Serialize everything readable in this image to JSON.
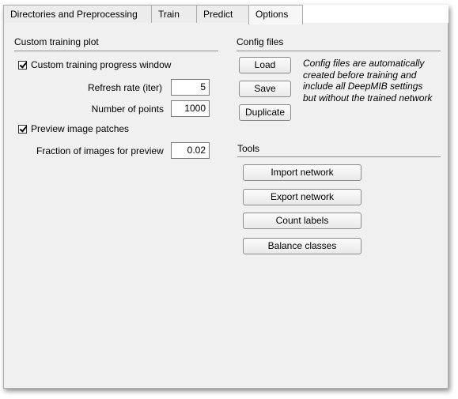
{
  "tabs": [
    {
      "label": "Directories and Preprocessing",
      "active": false
    },
    {
      "label": "Train",
      "active": false
    },
    {
      "label": "Predict",
      "active": false
    },
    {
      "label": "Options",
      "active": true
    }
  ],
  "custom_plot": {
    "title": "Custom training plot",
    "progress_window": {
      "label": "Custom training progress window",
      "checked": true
    },
    "refresh_rate": {
      "label": "Refresh rate (iter)",
      "value": "5"
    },
    "num_points": {
      "label": "Number of points",
      "value": "1000"
    },
    "preview_patches": {
      "label": "Preview image patches",
      "checked": true
    },
    "fraction_preview": {
      "label": "Fraction of images for preview",
      "value": "0.02"
    }
  },
  "config_files": {
    "title": "Config files",
    "load_label": "Load",
    "save_label": "Save",
    "duplicate_label": "Duplicate",
    "note_lines": [
      "Config files are automatically",
      "created before training and",
      "include all DeepMIB settings",
      "but without the trained network"
    ]
  },
  "tools": {
    "title": "Tools",
    "import_label": "Import network",
    "export_label": "Export network",
    "count_label": "Count labels",
    "balance_label": "Balance classes"
  }
}
